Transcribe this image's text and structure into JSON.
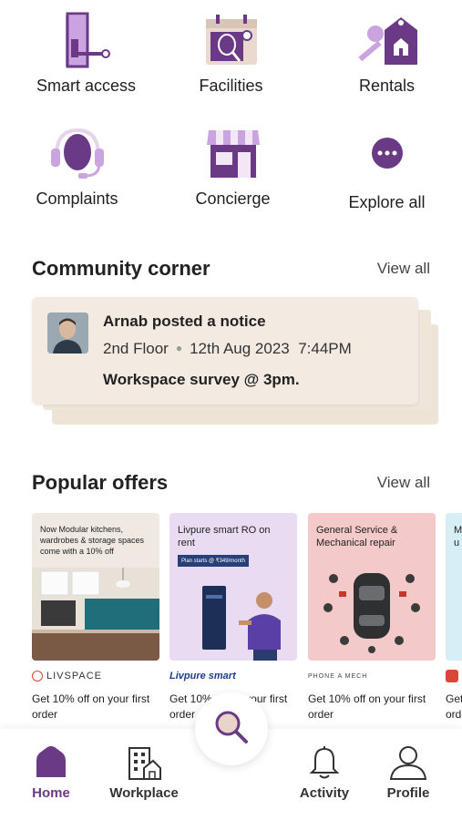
{
  "colors": {
    "accent": "#6b3a86",
    "accent_light": "#c9a4e0",
    "card_bg": "#f3ebe2"
  },
  "services": [
    {
      "label": "Smart access",
      "icon": "smart-access-icon"
    },
    {
      "label": "Facilities",
      "icon": "tennis-calendar-icon"
    },
    {
      "label": "Rentals",
      "icon": "house-key-icon"
    },
    {
      "label": "Complaints",
      "icon": "headset-icon"
    },
    {
      "label": "Concierge",
      "icon": "storefront-icon"
    },
    {
      "label": "Explore all",
      "icon": "more-dots-icon"
    }
  ],
  "community": {
    "title": "Community corner",
    "view_all": "View all",
    "post": {
      "title": "Arnab posted a notice",
      "location": "2nd Floor",
      "date": "12th Aug 2023",
      "time": "7:44PM",
      "body": "Workspace survey @ 3pm."
    }
  },
  "offers": {
    "title": "Popular offers",
    "view_all": "View all",
    "items": [
      {
        "headline": "Now Modular kitchens, wardrobes & storage spaces come with a 10% off",
        "brand": "LIVSPACE",
        "desc": "Get 10% off on your first order"
      },
      {
        "headline": "Livpure smart RO on rent",
        "tag": "Plan starts @ ₹349/month",
        "brand": "Livpure smart",
        "desc": "Get 10% off on your first order"
      },
      {
        "headline": "General Service & Mechanical repair",
        "brand": "PHONE A MECH",
        "desc": "Get 10% off on your first order"
      },
      {
        "headline": "M u",
        "brand": "",
        "desc": "Get ord"
      }
    ]
  },
  "nav": {
    "home": "Home",
    "workplace": "Workplace",
    "activity": "Activity",
    "profile": "Profile"
  }
}
